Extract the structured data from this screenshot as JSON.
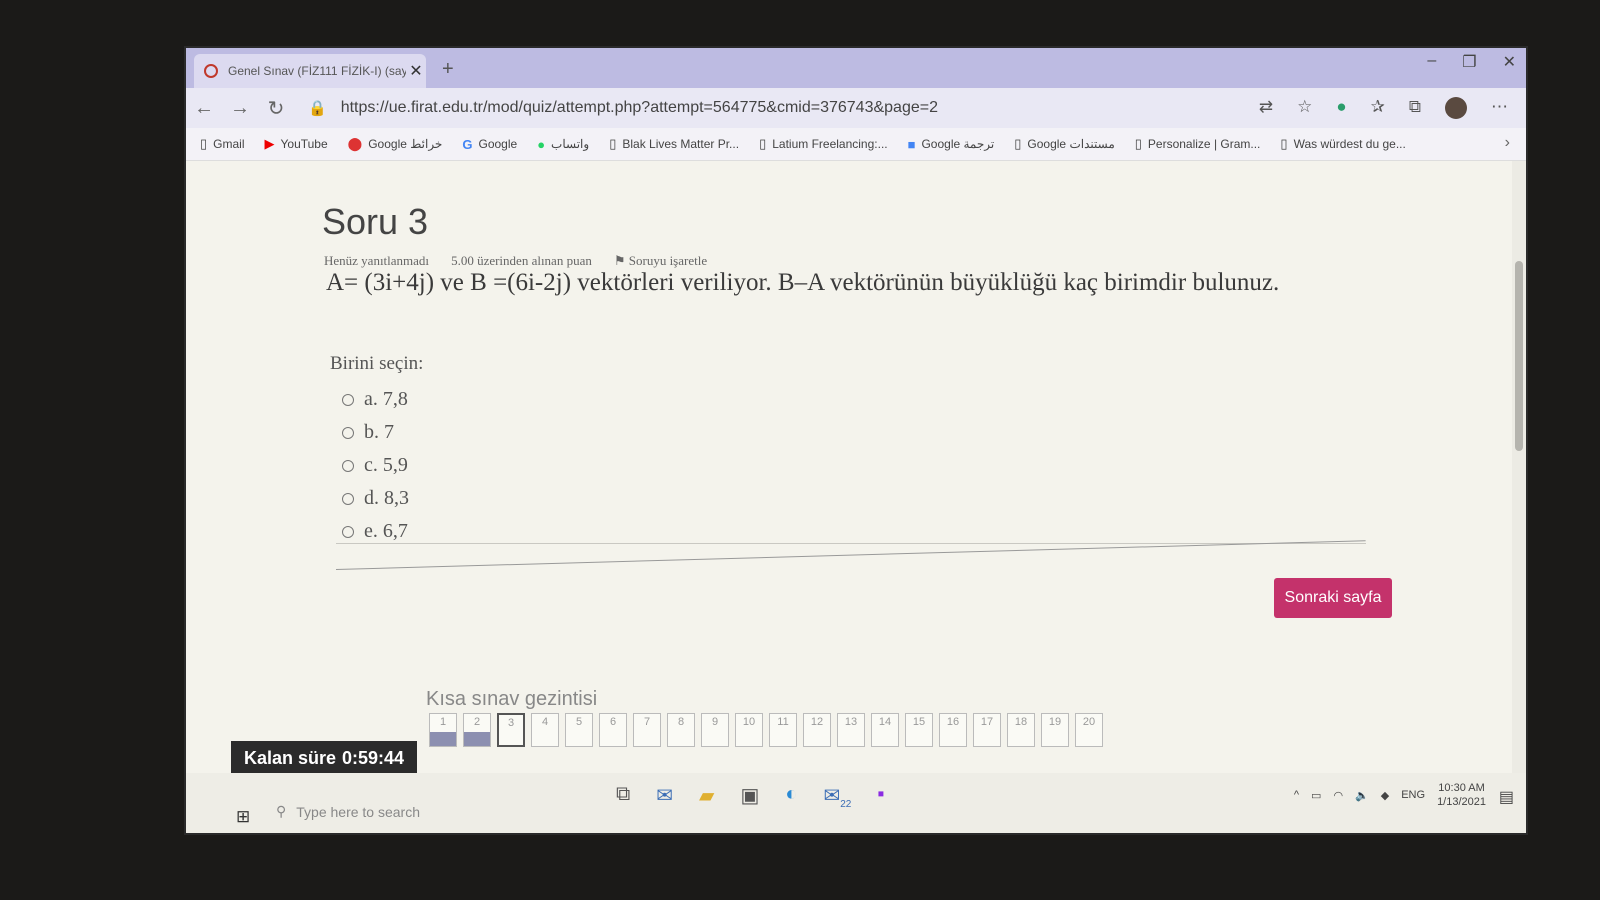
{
  "browser": {
    "tab_title": "Genel Sınav (FİZ111 FİZİK-I) (say",
    "url": "https://ue.firat.edu.tr/mod/quiz/attempt.php?attempt=564775&cmid=376743&page=2"
  },
  "bookmarks": [
    {
      "label": "Gmail"
    },
    {
      "label": "YouTube"
    },
    {
      "label": "Google خرائط"
    },
    {
      "label": "Google"
    },
    {
      "label": "واتساب"
    },
    {
      "label": "Blak Lives Matter Pr..."
    },
    {
      "label": "Latium Freelancing:..."
    },
    {
      "label": "Google ترجمة"
    },
    {
      "label": "Google مستندات"
    },
    {
      "label": "Personalize | Gram..."
    },
    {
      "label": "Was würdest du ge..."
    }
  ],
  "question": {
    "heading": "Soru 3",
    "status": "Henüz yanıtlanmadı",
    "points": "5.00 üzerinden alınan puan",
    "flag": "Soruyu işaretle",
    "text": "A= (3i+4j) ve B =(6i-2j) vektörleri veriliyor. B–A vektörünün büyüklüğü kaç birimdir bulunuz.",
    "prompt": "Birini seçin:",
    "options": [
      "a. 7,8",
      "b. 7",
      "c. 5,9",
      "d. 8,3",
      "e. 6,7"
    ]
  },
  "next_button": "Sonraki sayfa",
  "quiz_nav": {
    "title": "Kısa sınav gezintisi",
    "timer_label": "Kalan süre",
    "timer_value": "0:59:44",
    "questions": [
      "1",
      "2",
      "3",
      "4",
      "5",
      "6",
      "7",
      "8",
      "9",
      "10",
      "11",
      "12",
      "13",
      "14",
      "15",
      "16",
      "17",
      "18",
      "19",
      "20"
    ],
    "answered": [
      1,
      2
    ],
    "current": 3
  },
  "taskbar": {
    "search_placeholder": "Type here to search",
    "mail_badge": "22",
    "lang": "ENG",
    "time": "10:30 AM",
    "date": "1/13/2021"
  }
}
